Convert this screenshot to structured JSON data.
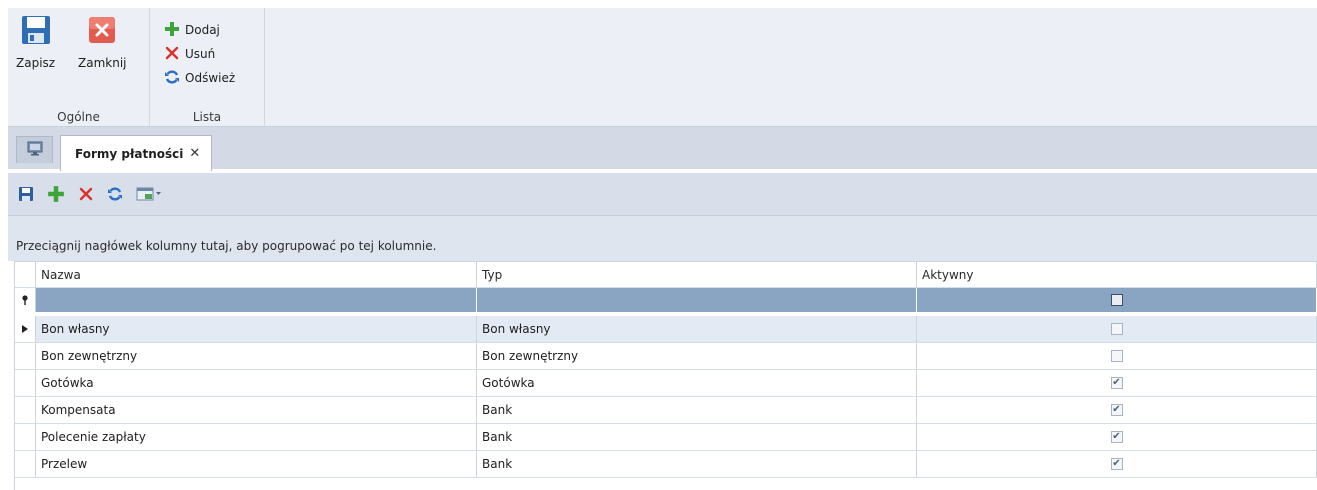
{
  "ribbon": {
    "groups": [
      {
        "label": "Ogólne"
      },
      {
        "label": "Lista"
      }
    ],
    "general": {
      "save_label": "Zapisz",
      "close_label": "Zamknij"
    },
    "list": {
      "add_label": "Dodaj",
      "delete_label": "Usuń",
      "refresh_label": "Odśwież"
    }
  },
  "tabs": {
    "home_icon": "monitor-icon",
    "active_label": "Formy płatności",
    "close_glyph": "✕"
  },
  "grid_toolbar": {
    "icons": [
      "save-icon",
      "add-icon",
      "delete-icon",
      "refresh-icon",
      "export-icon"
    ]
  },
  "group_panel": {
    "hint": "Przeciągnij nagłówek kolumny tutaj, aby pogrupować po tej kolumnie."
  },
  "grid": {
    "columns": [
      "Nazwa",
      "Typ",
      "Aktywny"
    ],
    "rows": [
      {
        "name": "Bon własny",
        "type": "Bon własny",
        "active": false
      },
      {
        "name": "Bon zewnętrzny",
        "type": "Bon zewnętrzny",
        "active": false
      },
      {
        "name": "Gotówka",
        "type": "Gotówka",
        "active": true
      },
      {
        "name": "Kompensata",
        "type": "Bank",
        "active": true
      },
      {
        "name": "Polecenie zapłaty",
        "type": "Bank",
        "active": true
      },
      {
        "name": "Przelew",
        "type": "Bank",
        "active": true
      }
    ],
    "selected_row": 0
  },
  "colors": {
    "accent_green": "#3ea33a",
    "accent_red": "#d9322a",
    "accent_blue": "#2a6fc4",
    "filter_row": "#8aa5c2"
  }
}
